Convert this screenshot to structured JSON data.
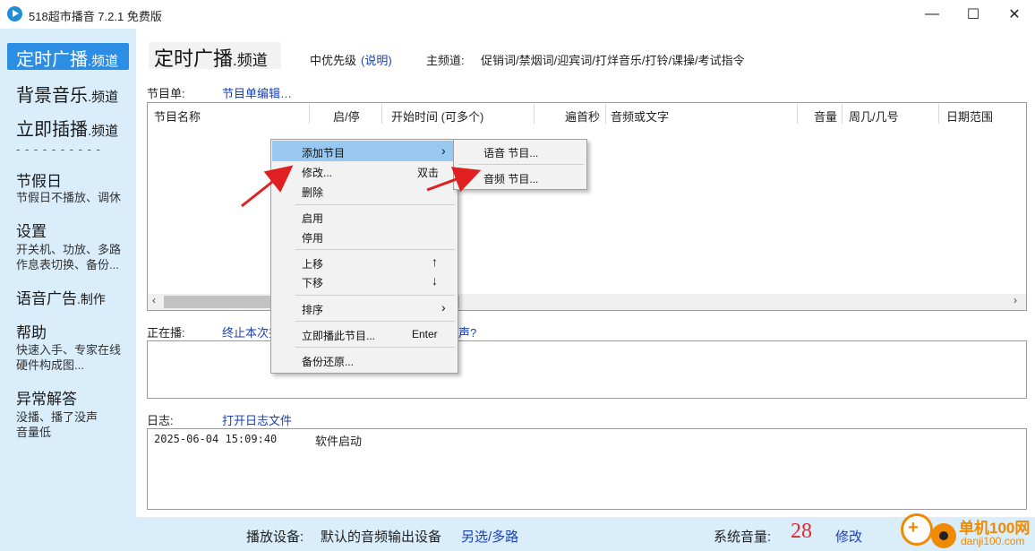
{
  "window": {
    "title": "518超市播音 7.2.1 免费版",
    "minimize_glyph": "—",
    "maximize_glyph": "☐",
    "close_glyph": "✕"
  },
  "sidebar": {
    "scheduled": {
      "main": "定时广播",
      "suffix": ".频道"
    },
    "background_music": {
      "main": "背景音乐",
      "suffix": ".频道"
    },
    "instant": {
      "main": "立即插播",
      "suffix": ".频道"
    },
    "divider": "- - - - - - - - - -",
    "holiday": {
      "title": "节假日",
      "sub": "节假日不播放、调休"
    },
    "settings": {
      "title": "设置",
      "sub1": "开关机、功放、多路",
      "sub2": "作息表切换、备份..."
    },
    "voice_ad": {
      "main": "语音广告",
      "suffix": ".制作"
    },
    "help": {
      "title": "帮助",
      "sub1": "快速入手、专家在线",
      "sub2": "硬件构成图..."
    },
    "faq": {
      "title": "异常解答",
      "sub1": "没播、播了没声",
      "sub2": "音量低"
    }
  },
  "header": {
    "title": "定时广播",
    "title_suffix": ".频道",
    "priority": "中优先级",
    "explain_link": "(说明)",
    "main_channel_label": "主频道:",
    "main_channel_value": "促销词/禁烟词/迎宾词/打烊音乐/打铃/课操/考试指令"
  },
  "program_list": {
    "label": "节目单:",
    "edit_link": "节目单编辑…",
    "columns": [
      "节目名称",
      "启/停",
      "开始时间 (可多个)",
      "遍首秒",
      "音频或文字",
      "音量",
      "周几/几号",
      "日期范围"
    ],
    "rows": []
  },
  "context_menu": {
    "add_program": "添加节目",
    "modify": "修改...",
    "modify_accel": "双击",
    "delete": "删除",
    "enable": "启用",
    "disable": "停用",
    "move_up": "上移",
    "move_up_accel": "↑",
    "move_down": "下移",
    "move_down_accel": "↓",
    "sort": "排序",
    "play_now": "立即播此节目...",
    "play_now_accel": "Enter",
    "backup_restore": "备份还原...",
    "submenu_arrow": "›"
  },
  "sub_menu": {
    "voice_program": "语音 节目...",
    "audio_program": "音频 节目..."
  },
  "now_playing": {
    "label": "正在播:",
    "stop_link": "终止本次播",
    "hidden_link_tail": "声?"
  },
  "log": {
    "label": "日志:",
    "open_link": "打开日志文件",
    "entries": [
      {
        "time": "2025-06-04 15:09:40",
        "message": "软件启动"
      }
    ]
  },
  "statusbar": {
    "device_label": "播放设备:",
    "device_value": "默认的音频输出设备",
    "device_link": "另选/多路",
    "volume_label": "系统音量:",
    "volume_value": "28",
    "volume_link": "修改"
  },
  "watermark": {
    "text": "单机100网",
    "url": "danji100.com",
    "plus": "+"
  },
  "colors": {
    "accent": "#2b8de3",
    "sidebar_bg": "#d9edfb",
    "link": "#1a3fb8",
    "volume": "#e0282e",
    "arrow": "#e02020",
    "menu_highlight": "#99c9f0"
  }
}
